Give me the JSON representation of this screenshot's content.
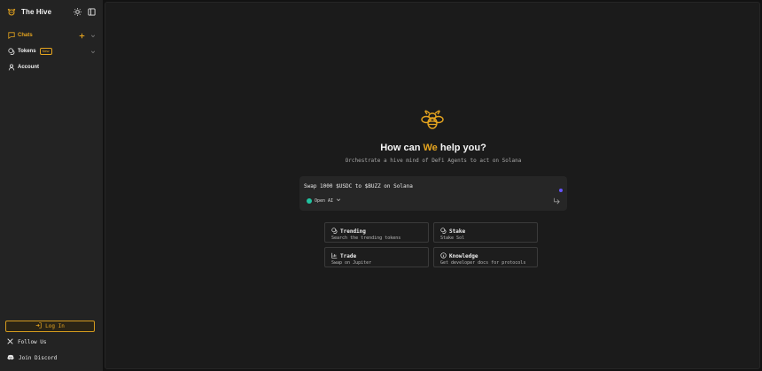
{
  "colors": {
    "accent": "#e6a51f",
    "sidebar": "#232323",
    "main": "#1b1b1b",
    "model_dot": "#21c3a0",
    "status_dot": "#6654ff"
  },
  "sidebar": {
    "brand": "The Hive",
    "items": [
      {
        "label": "Chats",
        "icon": "chat-icon",
        "active": true
      },
      {
        "label": "Tokens",
        "icon": "coins-icon",
        "badge": "New"
      },
      {
        "label": "Account",
        "icon": "user-icon"
      }
    ],
    "login_label": "Log In",
    "follow_label": "Follow Us",
    "discord_label": "Join Discord"
  },
  "main": {
    "heading_before": "How can ",
    "heading_highlight": "We",
    "heading_after": " help you?",
    "subheading": "Orchestrate a hive mind of DeFi Agents to act on Solana",
    "composer_text": "Swap 1000 $USDC to $BUZZ on Solana",
    "model_label": "Open AI",
    "cards": [
      {
        "title": "Trending",
        "desc": "Search the trending tokens",
        "icon": "coins-icon"
      },
      {
        "title": "Stake",
        "desc": "Stake Sol",
        "icon": "coins-icon"
      },
      {
        "title": "Trade",
        "desc": "Swap on Jupiter",
        "icon": "chart-icon"
      },
      {
        "title": "Knowledge",
        "desc": "Get developer docs for protocols",
        "icon": "info-icon"
      }
    ]
  }
}
